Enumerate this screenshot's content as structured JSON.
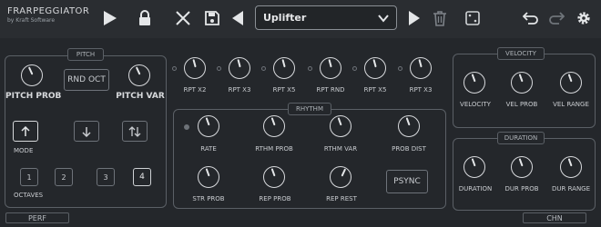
{
  "app": {
    "title": "FRARPEGGIATOR",
    "subtitle": "by Kraft Software"
  },
  "toolbar": {
    "preset_name": "Uplifter",
    "icons": [
      "play-icon",
      "lock-icon",
      "close-icon",
      "save-icon",
      "prev-preset-icon",
      "next-preset-icon",
      "trash-icon",
      "dice-icon",
      "undo-icon",
      "redo-icon",
      "gear-icon"
    ]
  },
  "pitch": {
    "title": "PITCH",
    "pitch_prob": "PITCH PROB",
    "rnd_oct": "RND OCT",
    "pitch_var": "PITCH VAR",
    "mode_label": "MODE",
    "octaves_label": "OCTAVES",
    "octaves": [
      "1",
      "2",
      "3",
      "4"
    ],
    "selected_octave": "4"
  },
  "repeats": {
    "labels": [
      "RPT X2",
      "RPT X3",
      "RPT X5",
      "RPT RND",
      "RPT X5",
      "RPT X3"
    ]
  },
  "rhythm": {
    "title": "RHYTHM",
    "row1": [
      "RATE",
      "RTHM PROB",
      "RTHM VAR",
      "PROB DIST"
    ],
    "row2": [
      "STR PROB",
      "REP PROB",
      "REP REST"
    ],
    "psync": "PSYNC"
  },
  "velocity": {
    "title": "VELOCITY",
    "labels": [
      "VELOCITY",
      "VEL PROB",
      "VEL RANGE"
    ]
  },
  "duration": {
    "title": "DURATION",
    "labels": [
      "DURATION",
      "DUR PROB",
      "DUR RANGE"
    ]
  },
  "footer": {
    "left": "PERF",
    "right": "CHN"
  }
}
